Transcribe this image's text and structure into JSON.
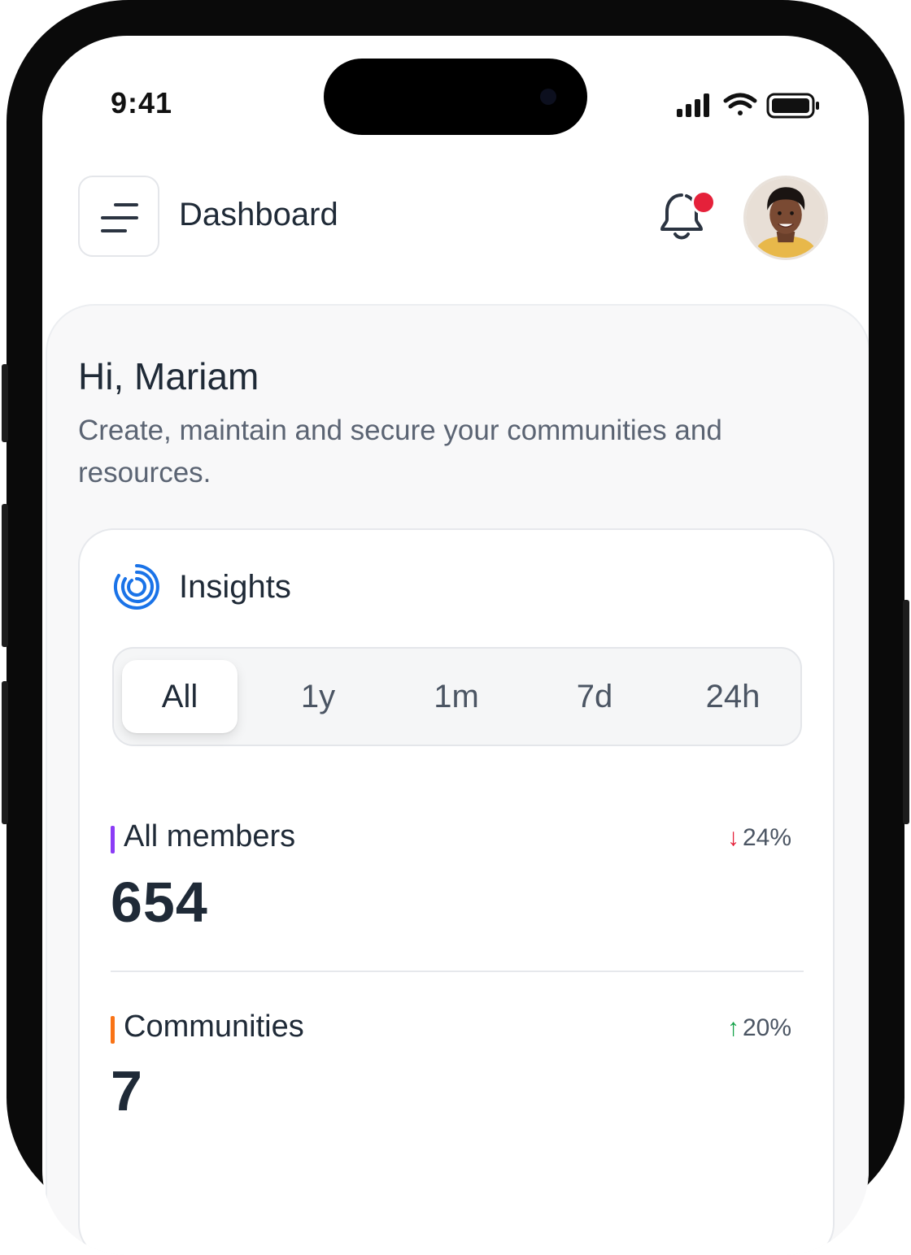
{
  "status_bar": {
    "time": "9:41",
    "icons": [
      "cellular-signal-icon",
      "wifi-icon",
      "battery-icon"
    ]
  },
  "header": {
    "title": "Dashboard",
    "menu_icon": "menu-icon",
    "notification_icon": "bell-icon",
    "has_unread_notification": true,
    "avatar_icon": "user-avatar"
  },
  "greeting": {
    "title": "Hi, Mariam",
    "subtitle": "Create, maintain and secure your communities and resources."
  },
  "insights": {
    "title": "Insights",
    "icon": "insights-spiral-icon",
    "periods": [
      "All",
      "1y",
      "1m",
      "7d",
      "24h"
    ],
    "selected_period": "All",
    "metrics": [
      {
        "label": "All members",
        "value": "654",
        "change": "24%",
        "direction": "down",
        "accent": "#8b3cf6",
        "change_color": "#e5213a"
      },
      {
        "label": "Communities",
        "value": "7",
        "change": "20%",
        "direction": "up",
        "accent": "#f97316",
        "change_color": "#16a34a"
      }
    ]
  },
  "colors": {
    "accent_blue": "#1a73e8",
    "notification_dot": "#e5213a",
    "text_primary": "#1f2a37",
    "text_secondary": "#5b6473"
  }
}
